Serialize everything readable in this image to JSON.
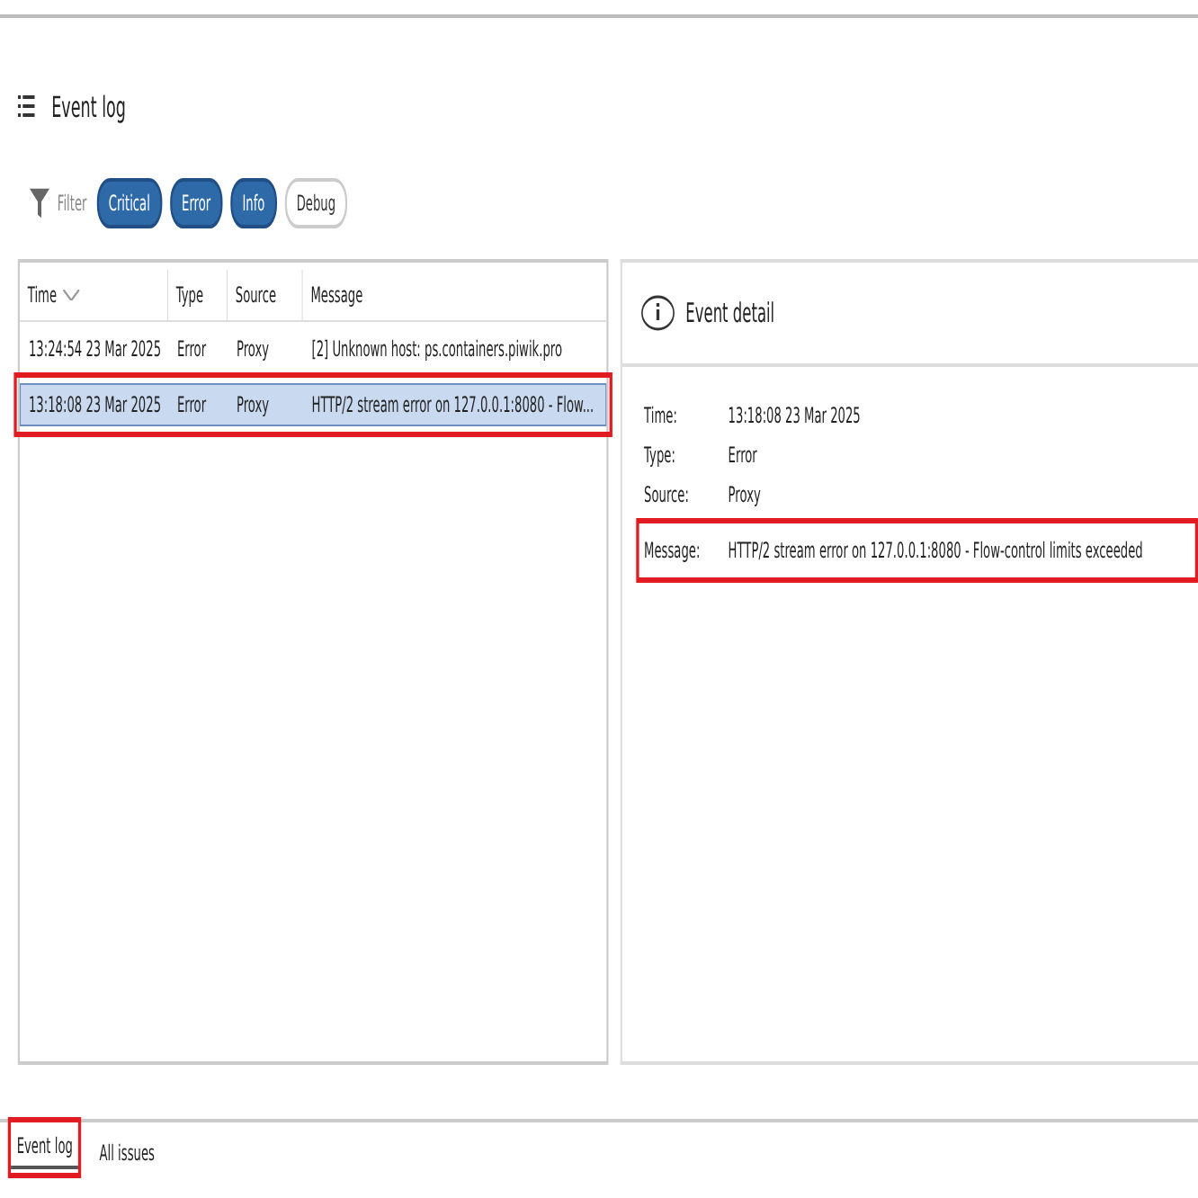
{
  "header": {
    "title": "Event log"
  },
  "filter": {
    "label": "Filter",
    "chips": [
      {
        "label": "Critical",
        "selected": true
      },
      {
        "label": "Error",
        "selected": true
      },
      {
        "label": "Info",
        "selected": true
      },
      {
        "label": "Debug",
        "selected": false
      }
    ]
  },
  "table": {
    "columns": [
      {
        "label": "Time",
        "sorted": true
      },
      {
        "label": "Type",
        "sorted": false
      },
      {
        "label": "Source",
        "sorted": false
      },
      {
        "label": "Message",
        "sorted": false
      }
    ],
    "rows": [
      {
        "cells": [
          "13:24:54 23 Mar 2025",
          "Error",
          "Proxy",
          "[2]  Unknown host: ps.containers.piwik.pro"
        ],
        "selected": false,
        "highlighted": false
      },
      {
        "cells": [
          "13:18:08 23 Mar 2025",
          "Error",
          "Proxy",
          "HTTP/2 stream error on 127.0.0.1:8080 - Flow..."
        ],
        "selected": true,
        "highlighted": true
      }
    ]
  },
  "detail": {
    "title": "Event detail",
    "fields": [
      {
        "label": "Time:",
        "value": "13:18:08 23 Mar 2025",
        "highlighted": false
      },
      {
        "label": "Type:",
        "value": "Error",
        "highlighted": false
      },
      {
        "label": "Source:",
        "value": "Proxy",
        "highlighted": false
      },
      {
        "label": "Message:",
        "value": "HTTP/2 stream error on 127.0.0.1:8080 - Flow-control limits exceeded",
        "highlighted": true
      }
    ]
  },
  "bottom_tabs": [
    {
      "label": "Event log",
      "selected": true,
      "highlighted": true
    },
    {
      "label": "All issues",
      "selected": false,
      "highlighted": false
    }
  ]
}
